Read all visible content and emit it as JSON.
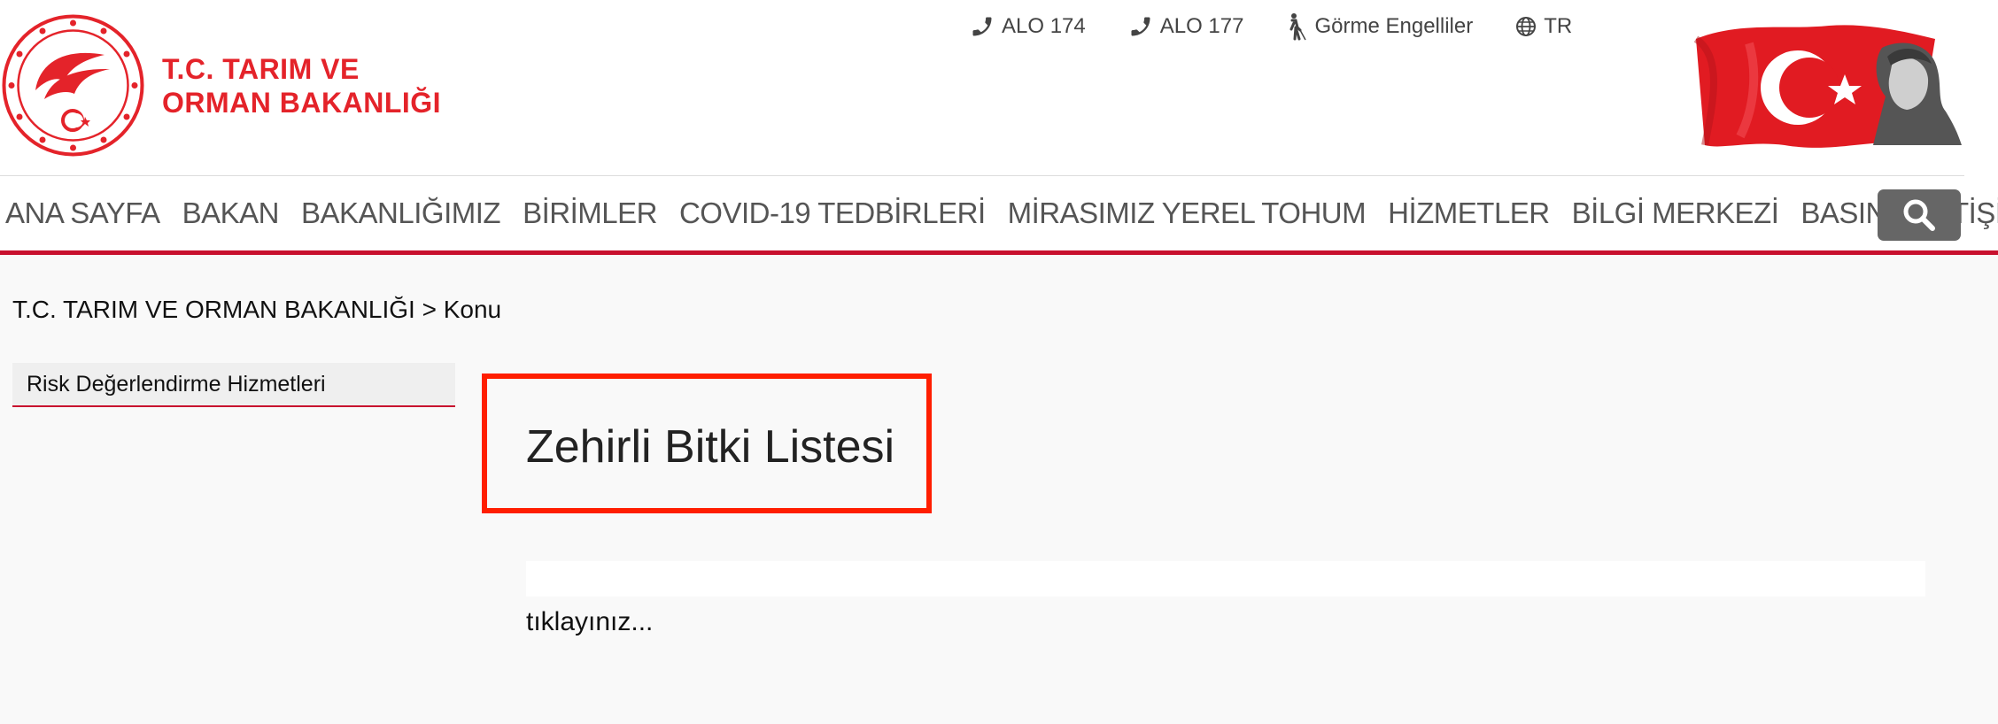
{
  "header": {
    "logo_line1": "T.C. TARIM VE",
    "logo_line2": "ORMAN BAKANLIĞI",
    "top_links": [
      {
        "label": "ALO 174",
        "icon": "phone-icon"
      },
      {
        "label": "ALO 177",
        "icon": "phone-icon"
      },
      {
        "label": "Görme Engelliler",
        "icon": "blind-person-icon"
      },
      {
        "label": "TR",
        "icon": "globe-icon"
      }
    ]
  },
  "nav": {
    "items": [
      "ANA SAYFA",
      "BAKAN",
      "BAKANLIĞIMIZ",
      "BİRİMLER",
      "COVID-19 TEDBİRLERİ",
      "MİRASIMIZ YEREL TOHUM",
      "HİZMETLER",
      "BİLGİ MERKEZİ",
      "BASIN",
      "İLETİŞİM"
    ],
    "search_icon": "search-icon"
  },
  "breadcrumb": "T.C. TARIM VE ORMAN BAKANLIĞI > Konu",
  "sidebar": {
    "items": [
      "Risk Değerlendirme Hizmetleri"
    ]
  },
  "main": {
    "title": "Zehirli Bitki Listesi",
    "link_text": "tıklayınız..."
  },
  "colors": {
    "brand_red": "#e4232a",
    "nav_border": "#c8102e",
    "highlight_box": "#ff1e00",
    "search_button": "#666666"
  }
}
